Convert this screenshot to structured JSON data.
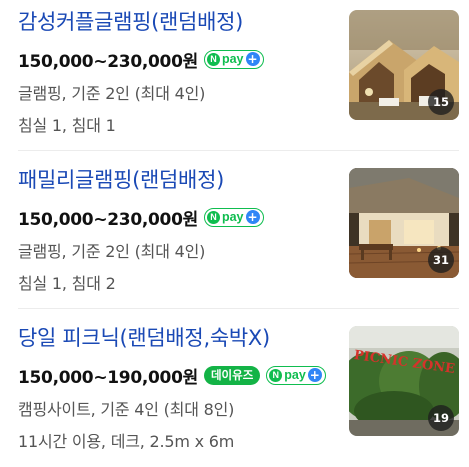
{
  "listings": [
    {
      "title": "감성커플글램핑(랜덤배정)",
      "price": "150,000~230,000원",
      "badge": "",
      "npay_label": "pay",
      "info_line1": "글램핑, 기준 2인 (최대 4인)",
      "info_line2": "침실 1, 침대 1",
      "photo_count": "15"
    },
    {
      "title": "패밀리글램핑(랜덤배정)",
      "price": "150,000~230,000원",
      "badge": "",
      "npay_label": "pay",
      "info_line1": "글램핑, 기준 2인 (최대 4인)",
      "info_line2": "침실 1, 침대 2",
      "photo_count": "31"
    },
    {
      "title": "당일 피크닉(랜덤배정,숙박X)",
      "price": "150,000~190,000원",
      "badge": "데이유즈",
      "npay_label": "pay",
      "info_line1": "캠핑사이트, 기준 4인 (최대 8인)",
      "info_line2": "11시간 이용, 데크, 2.5m x 6m",
      "photo_count": "19",
      "photo_sign_text": "PICNIC ZONE"
    }
  ],
  "npay_logo_letter": "N",
  "npay_plus": "+"
}
